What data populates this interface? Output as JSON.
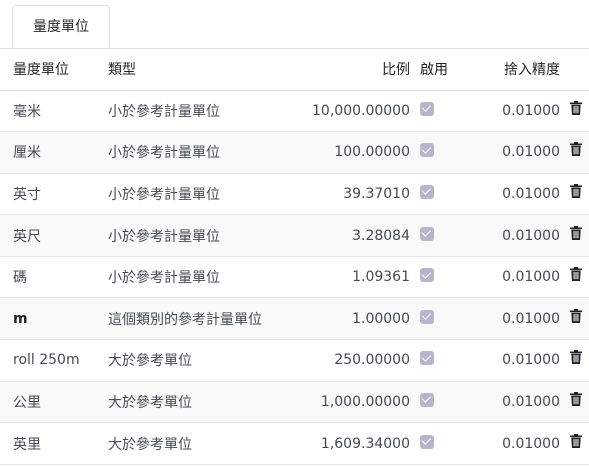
{
  "tab": {
    "label": "量度單位"
  },
  "columns": {
    "name": "量度單位",
    "type": "類型",
    "ratio": "比例",
    "active": "啟用",
    "rounding": "捨入精度"
  },
  "rows": [
    {
      "name": "毫米",
      "type": "小於參考計量單位",
      "ratio": "10,000.00000",
      "active": true,
      "rounding": "0.01000"
    },
    {
      "name": "厘米",
      "type": "小於參考計量單位",
      "ratio": "100.00000",
      "active": true,
      "rounding": "0.01000"
    },
    {
      "name": "英寸",
      "type": "小於參考計量單位",
      "ratio": "39.37010",
      "active": true,
      "rounding": "0.01000"
    },
    {
      "name": "英尺",
      "type": "小於參考計量單位",
      "ratio": "3.28084",
      "active": true,
      "rounding": "0.01000"
    },
    {
      "name": "碼",
      "type": "小於參考計量單位",
      "ratio": "1.09361",
      "active": true,
      "rounding": "0.01000"
    },
    {
      "name": "m",
      "type": "這個類別的參考計量單位",
      "ratio": "1.00000",
      "active": true,
      "rounding": "0.01000"
    },
    {
      "name": "roll 250m",
      "type": "大於參考單位",
      "ratio": "250.00000",
      "active": true,
      "rounding": "0.01000"
    },
    {
      "name": "公里",
      "type": "大於參考單位",
      "ratio": "1,000.00000",
      "active": true,
      "rounding": "0.01000"
    },
    {
      "name": "英里",
      "type": "大於參考單位",
      "ratio": "1,609.34000",
      "active": true,
      "rounding": "0.01000"
    }
  ],
  "colors": {
    "checkbox": "#b9b4ca",
    "border": "#dee2e6",
    "stripe": "#f9f9f9"
  },
  "icons": {
    "checkbox": "checked-checkbox-icon",
    "delete": "trash-icon"
  }
}
